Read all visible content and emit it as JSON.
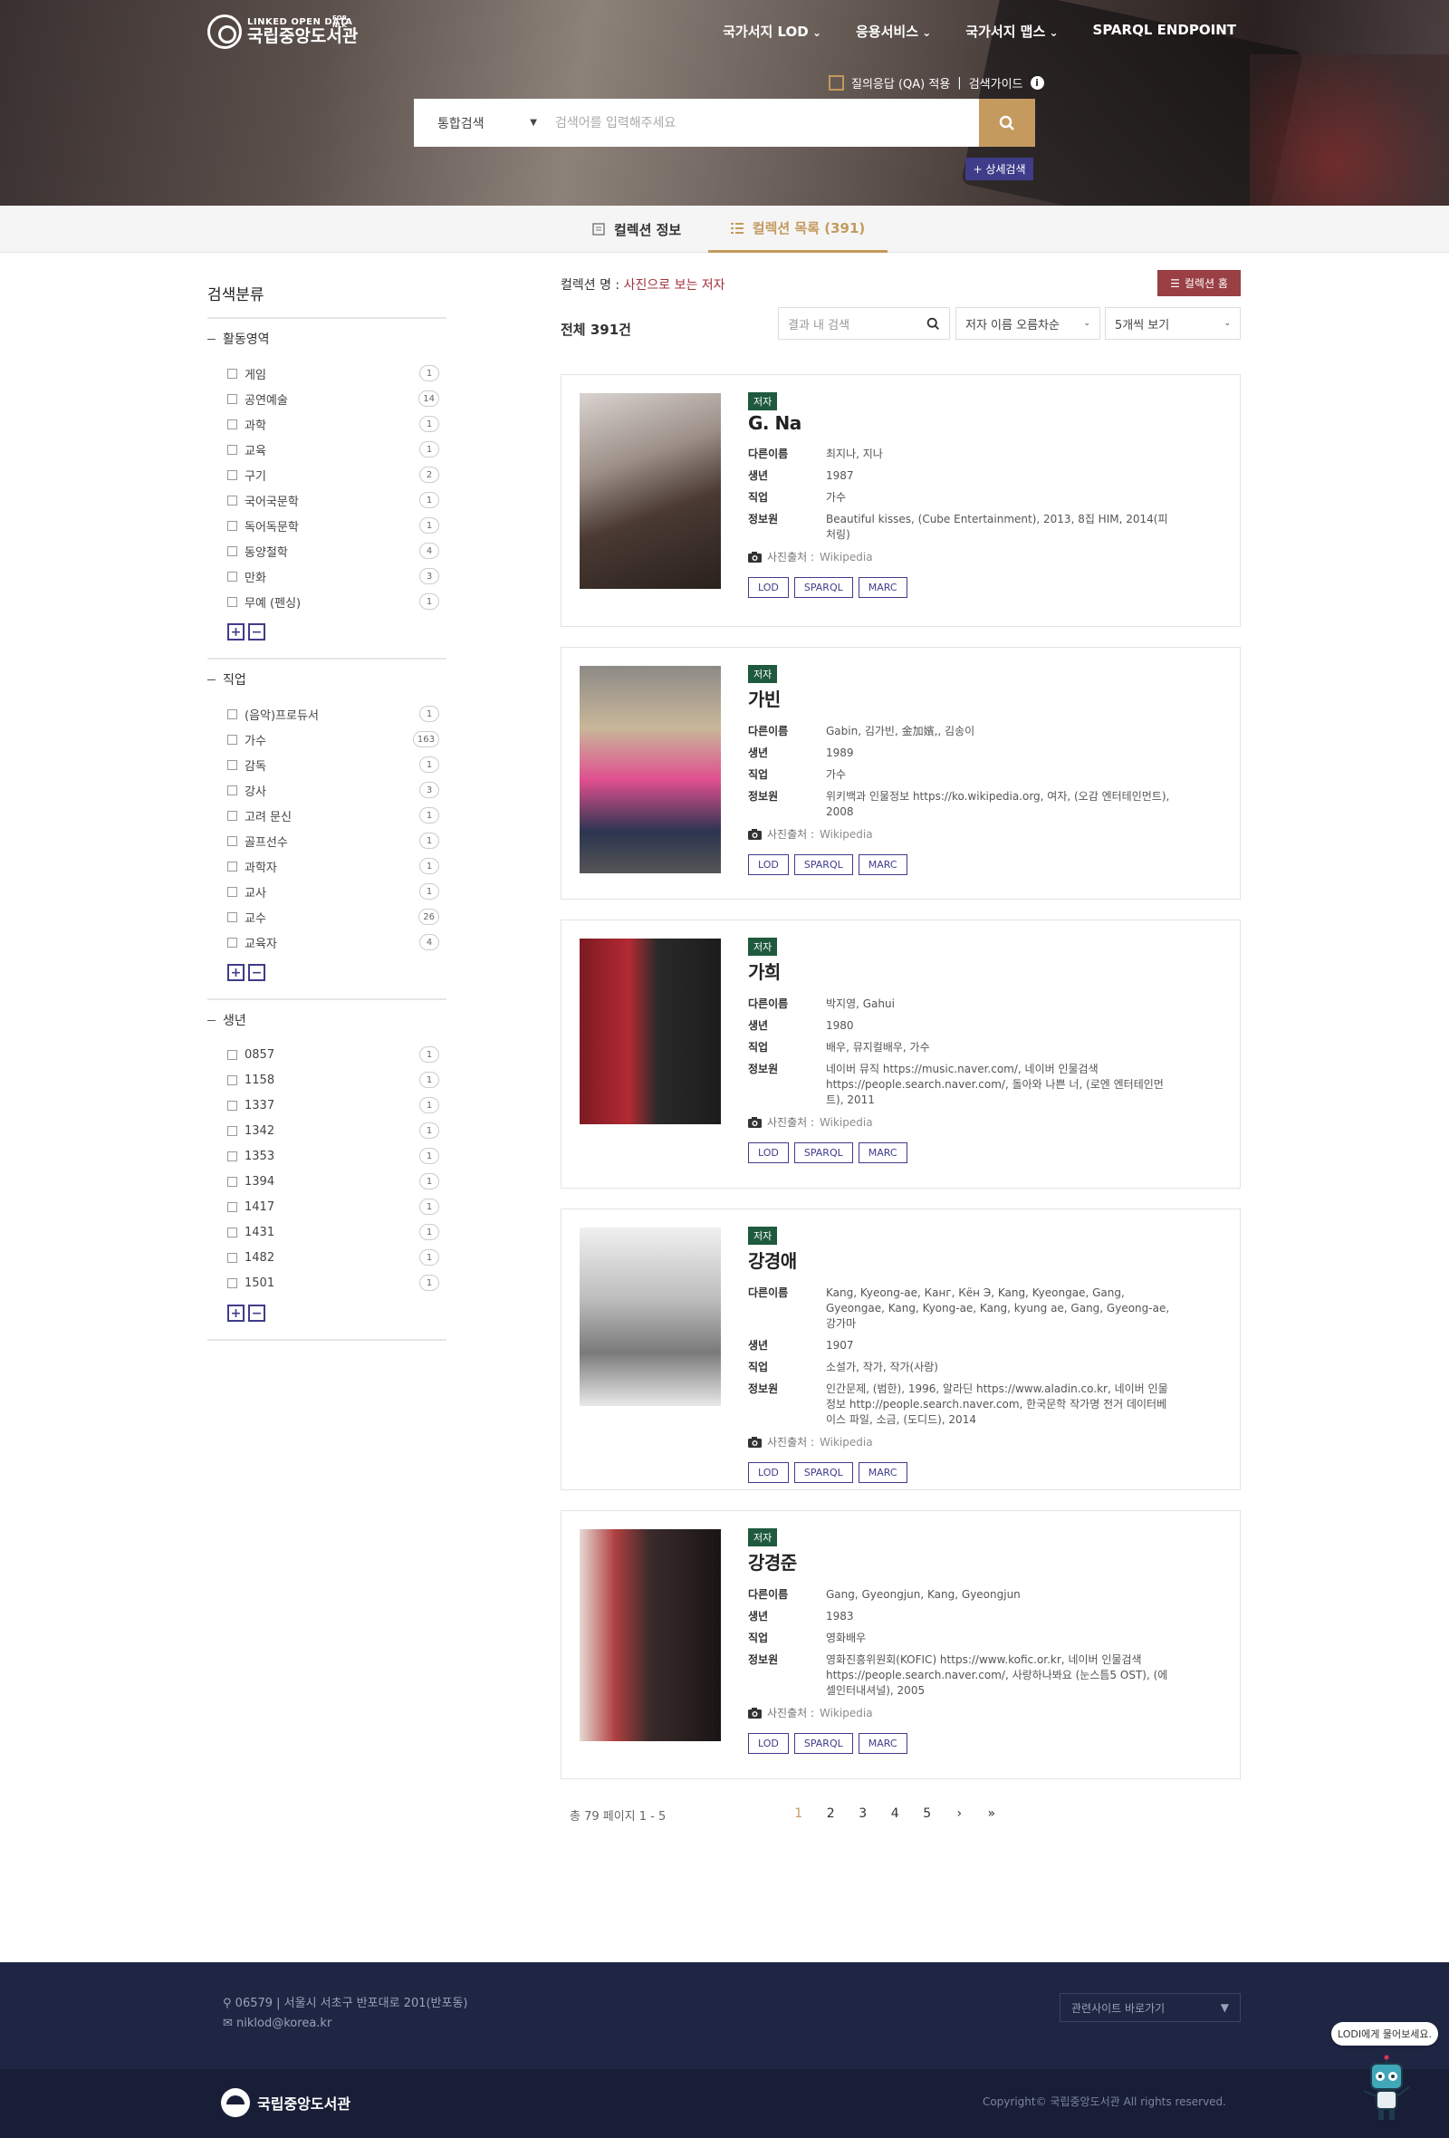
{
  "header": {
    "logo_small": "LINKED OPEN DATA",
    "logo_sup": "FOR NLK",
    "logo_big": "국립중앙도서관",
    "nav": [
      "국가서지 LOD",
      "응용서비스",
      "국가서지 맵스",
      "SPARQL ENDPOINT"
    ],
    "qa_label": "질의응답 (QA) 적용",
    "guide_label": "검색가이드",
    "search_scope": "통합검색",
    "search_placeholder": "검색어를 입력해주세요",
    "advanced_label": "+ 상세검색"
  },
  "tabs": [
    {
      "label": "컬렉션 정보"
    },
    {
      "label": "컬렉션 목록 (391)"
    }
  ],
  "sidebar": {
    "title": "검색분류",
    "groups": [
      {
        "title": "활동영역",
        "items": [
          {
            "label": "게임",
            "count": "1"
          },
          {
            "label": "공연예술",
            "count": "14"
          },
          {
            "label": "과학",
            "count": "1"
          },
          {
            "label": "교육",
            "count": "1"
          },
          {
            "label": "구기",
            "count": "2"
          },
          {
            "label": "국어국문학",
            "count": "1"
          },
          {
            "label": "독어독문학",
            "count": "1"
          },
          {
            "label": "동양철학",
            "count": "4"
          },
          {
            "label": "만화",
            "count": "3"
          },
          {
            "label": "무예 (펜싱)",
            "count": "1"
          }
        ]
      },
      {
        "title": "직업",
        "items": [
          {
            "label": "(음악)프로듀서",
            "count": "1"
          },
          {
            "label": "가수",
            "count": "163"
          },
          {
            "label": "감독",
            "count": "1"
          },
          {
            "label": "강사",
            "count": "3"
          },
          {
            "label": "고려 문신",
            "count": "1"
          },
          {
            "label": "골프선수",
            "count": "1"
          },
          {
            "label": "과학자",
            "count": "1"
          },
          {
            "label": "교사",
            "count": "1"
          },
          {
            "label": "교수",
            "count": "26"
          },
          {
            "label": "교육자",
            "count": "4"
          }
        ]
      },
      {
        "title": "생년",
        "items": [
          {
            "label": "0857",
            "count": "1"
          },
          {
            "label": "1158",
            "count": "1"
          },
          {
            "label": "1337",
            "count": "1"
          },
          {
            "label": "1342",
            "count": "1"
          },
          {
            "label": "1353",
            "count": "1"
          },
          {
            "label": "1394",
            "count": "1"
          },
          {
            "label": "1417",
            "count": "1"
          },
          {
            "label": "1431",
            "count": "1"
          },
          {
            "label": "1482",
            "count": "1"
          },
          {
            "label": "1501",
            "count": "1"
          }
        ]
      }
    ]
  },
  "main": {
    "collection_label": "컬렉션 명 :",
    "collection_name": "사진으로 보는 저자",
    "home_label": "컬렉션 홈",
    "total_label": "전체 391건",
    "in_search_placeholder": "결과 내 검색",
    "sort_label": "저자 이름 오름차순",
    "page_size_label": "5개씩 보기",
    "field_labels": {
      "alt": "다른이름",
      "birth": "생년",
      "job": "직업",
      "source": "정보원"
    },
    "photo_source_label": "사진출처 :",
    "photo_source_value": "Wikipedia",
    "results": [
      {
        "badge": "저자",
        "name": "G. Na",
        "alt": "최지나, 지나",
        "birth": "1987",
        "job": "가수",
        "source": "Beautiful kisses, (Cube Entertainment), 2013, 8집 HIM, 2014(피처링)",
        "buttons": [
          "LOD",
          "SPARQL",
          "MARC"
        ]
      },
      {
        "badge": "저자",
        "name": "가빈",
        "alt": "Gabin, 김가빈, 金加嬪,, 김송이",
        "birth": "1989",
        "job": "가수",
        "source": "위키백과 인물정보 https://ko.wikipedia.org, 여자, (오감 엔터테인먼트), 2008",
        "buttons": [
          "LOD",
          "SPARQL",
          "MARC"
        ]
      },
      {
        "badge": "저자",
        "name": "가희",
        "alt": "박지영, Gahui",
        "birth": "1980",
        "job": "배우, 뮤지컬배우, 가수",
        "source": "네이버 뮤직 https://music.naver.com/, 네이버 인물검색 https://people.search.naver.com/, 돌아와 나쁜 너, (로엔 엔터테인먼트), 2011",
        "buttons": [
          "LOD",
          "SPARQL",
          "MARC"
        ]
      },
      {
        "badge": "저자",
        "name": "강경애",
        "alt": "Kang, Kyeong-ae, Канг, Кён Э, Kang, Kyeongae, Gang, Gyeongae, Kang, Kyong-ae, Kang, kyung ae, Gang, Gyeong-ae, 강가마",
        "birth": "1907",
        "job": "소설가, 작가, 작가(사람)",
        "source": "인간문제, (범한), 1996, 알라딘 https://www.aladin.co.kr, 네이버 인물정보 http://people.search.naver.com, 한국문학 작가명 전거 데이터베이스 파일, 소금, (도디드), 2014",
        "buttons": [
          "LOD",
          "SPARQL",
          "MARC"
        ]
      },
      {
        "badge": "저자",
        "name": "강경준",
        "alt": "Gang, Gyeongjun, Kang, Gyeongjun",
        "birth": "1983",
        "job": "영화배우",
        "source": "영화진흥위원회(KOFIC) https://www.kofic.or.kr, 네이버 인물검색 https://people.search.naver.com/, 사랑하나봐요 (눈스틈5 OST), (에셀인터내셔널), 2005",
        "buttons": [
          "LOD",
          "SPARQL",
          "MARC"
        ]
      }
    ]
  },
  "pagination": {
    "info": "총 79 페이지 1 - 5",
    "pages": [
      "1",
      "2",
      "3",
      "4",
      "5"
    ],
    "next": "›",
    "last": "»"
  },
  "footer": {
    "address": "06579 | 서울시 서초구 반포대로 201(반포동)",
    "email": "niklod@korea.kr",
    "related_sites": "관련사이트 바로가기",
    "logo_text": "국립중앙도서관",
    "copyright": "Copyright© 국립중앙도서관 All rights reserved.",
    "chatbot_bubble": "LODI에게 물어보세요."
  },
  "colors": {
    "accent": "#c49a5f",
    "navy": "#3f3c8a",
    "badge": "#1f5a3e",
    "footer": "#1f2643",
    "collection": "#a2333d"
  }
}
